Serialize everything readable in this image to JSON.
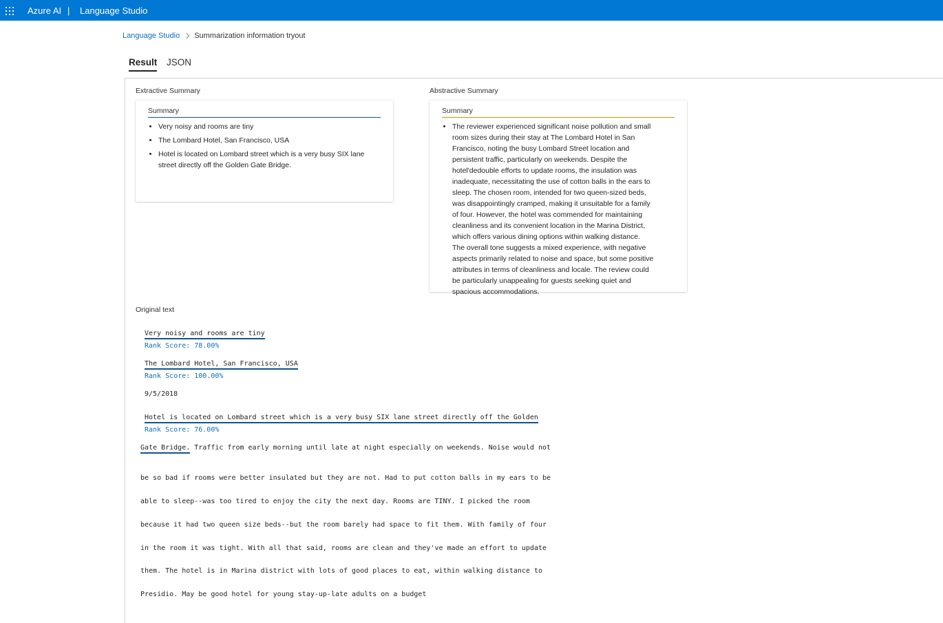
{
  "header": {
    "brand": "Azure AI",
    "separator": "|",
    "product": "Language Studio",
    "menu_icon": "waffle-icon"
  },
  "breadcrumb": {
    "root": "Language Studio",
    "current": "Summarization information tryout"
  },
  "tabs": [
    {
      "label": "Result",
      "active": true
    },
    {
      "label": "JSON",
      "active": false
    }
  ],
  "extractive": {
    "title": "Extractive Summary",
    "header": "Summary",
    "items": [
      "Very noisy and rooms are tiny",
      "The Lombard Hotel, San Francisco, USA",
      "Hotel is located on Lombard street which is a very busy SIX lane street directly off the Golden Gate Bridge."
    ]
  },
  "abstractive": {
    "title": "Abstractive Summary",
    "header": "Summary",
    "items": [
      "The reviewer experienced significant noise pollution and small room sizes during their stay at The Lombard Hotel in San Francisco, noting the busy Lombard Street location and persistent traffic, particularly on weekends. Despite the hotel'dedouble efforts to update rooms, the insulation was inadequate, necessitating the use of cotton balls in the ears to sleep. The chosen room, intended for two queen-sized beds, was disappointingly cramped, making it unsuitable for a family of four. However, the hotel was commended for maintaining cleanliness and its convenient location in the Marina District, which offers various dining options within walking distance. The overall tone suggests a mixed experience, with negative aspects primarily related to noise and space, but some positive attributes in terms of cleanliness and locale. The review could be particularly unappealing for guests seeking quiet and spacious accommodations."
    ]
  },
  "original": {
    "title": "Original text",
    "sentence1": "Very noisy and rooms are tiny",
    "rank1": "Rank Score: 78.00%",
    "sentence2": "The Lombard Hotel, San Francisco, USA",
    "rank2": "Rank Score: 100.00%",
    "date": "9/5/2018",
    "sentence3_part1": "Hotel is located on Lombard street which is a very busy SIX lane street directly off the Golden",
    "rank3": "Rank Score: 76.00%",
    "sentence3_part2": "Gate Bridge.",
    "line1_rest": " Traffic from early morning until late at night especially on weekends. Noise would not",
    "lines": [
      "be so bad if rooms were better insulated but they are not. Had to put cotton balls in my ears to be",
      "able to sleep--was too tired to enjoy the city the next day. Rooms are TINY. I picked the room",
      "because it had two queen size beds--but the room barely had space to fit them. With family of four",
      "in the room it was tight. With all that said, rooms are clean and they've made an effort to update",
      "them. The hotel is in Marina district with lots of good places to eat, within walking distance to",
      "Presidio. May be good hotel for young stay-up-late adults on a budget"
    ]
  }
}
